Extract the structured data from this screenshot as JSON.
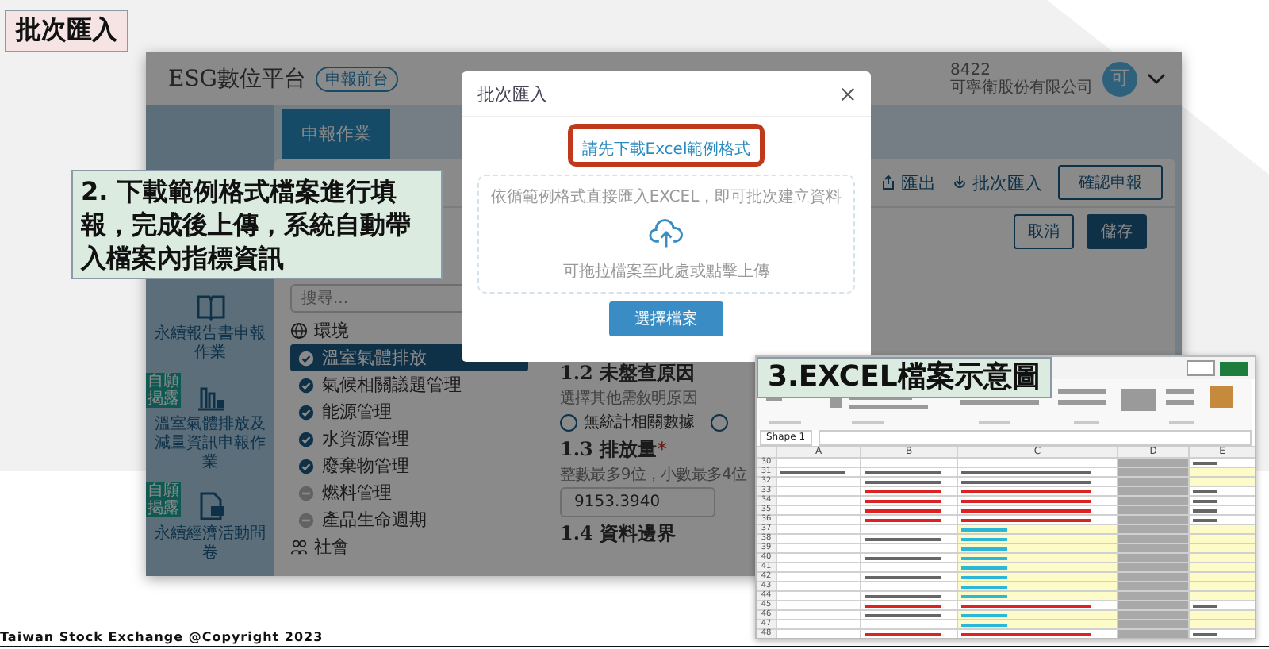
{
  "slide_title": "批次匯入",
  "app": {
    "brand": "ESG數位平台",
    "brand_badge": "申報前台",
    "company_code": "8422",
    "company_name": "可寧衛股份有限公司",
    "avatar": "可",
    "tabs": [
      {
        "label": "申報作業",
        "selected": true
      }
    ],
    "sidebar": [
      {
        "label": "永續報告書申報作業"
      },
      {
        "label": "溫室氣體排放及減量資訊申報作業",
        "badge": "自願揭露"
      },
      {
        "label": "永續經濟活動問卷",
        "badge": "自願揭露"
      }
    ],
    "toolbar": {
      "export": "匯出",
      "import": "批次匯入",
      "confirm": "確認申報"
    },
    "actions": {
      "cancel": "取消",
      "save": "儲存"
    },
    "search": {
      "placeholder": "搜尋..."
    },
    "nav": [
      {
        "label": "環境",
        "items": [
          {
            "label": "溫室氣體排放",
            "checked": true,
            "selected": true
          },
          {
            "label": "氣候相關議題管理",
            "checked": true,
            "selected": false
          },
          {
            "label": "能源管理",
            "checked": true,
            "selected": false
          },
          {
            "label": "水資源管理",
            "checked": true,
            "selected": false
          },
          {
            "label": "廢棄物管理",
            "checked": true,
            "selected": false
          },
          {
            "label": "燃料管理",
            "checked": false,
            "selected": false
          },
          {
            "label": "產品生命週期",
            "checked": false,
            "selected": false
          }
        ]
      },
      {
        "label": "社會"
      }
    ],
    "form": [
      {
        "kind": "radio",
        "title": "1.2 未盤查原因",
        "hint": "選擇其他需敘明原因",
        "options": [
          {
            "label": "無統計相關數據",
            "selected": false
          },
          {
            "selected": false
          }
        ]
      },
      {
        "kind": "input",
        "title": "1.3 排放量",
        "required_mark": "*",
        "hint": "整數最多9位，小數最多4位",
        "value": "9153.3940"
      },
      {
        "kind": "heading",
        "title": "1.4 資料邊界"
      }
    ],
    "modal": {
      "title": "批次匯入",
      "link": "請先下載Excel範例格式",
      "drop_text": "依循範例格式直接匯入EXCEL，即可批次建立資料",
      "drop_hint": "可拖拉檔案至此處或點擊上傳",
      "button": "選擇檔案"
    }
  },
  "callouts": [
    {
      "kind": "step",
      "text": "2. 下載範例格式檔案進行填報，完成後上傳，系統自動帶入檔案內指標資訊"
    },
    {
      "kind": "caption",
      "text": "3.EXCEL檔案示意圖"
    }
  ],
  "excel": {
    "name_box": "Shape 1",
    "columns": [
      "A",
      "B",
      "C",
      "D",
      "E"
    ],
    "rows": [
      {
        "num": "30",
        "kind": "plain"
      },
      {
        "num": "31",
        "kind": "black"
      },
      {
        "num": "32",
        "kind": "black"
      },
      {
        "num": "33",
        "kind": "red"
      },
      {
        "num": "34",
        "kind": "red"
      },
      {
        "num": "35",
        "kind": "red"
      },
      {
        "num": "36",
        "kind": "red"
      },
      {
        "num": "37",
        "kind": "blue"
      },
      {
        "num": "38",
        "kind": "blue"
      },
      {
        "num": "39",
        "kind": "blue"
      },
      {
        "num": "40",
        "kind": "blue"
      },
      {
        "num": "41",
        "kind": "blue"
      },
      {
        "num": "42",
        "kind": "blue"
      },
      {
        "num": "43",
        "kind": "blue"
      },
      {
        "num": "44",
        "kind": "blue"
      },
      {
        "num": "45",
        "kind": "red"
      },
      {
        "num": "46",
        "kind": "blue"
      },
      {
        "num": "47",
        "kind": "blue"
      },
      {
        "num": "48",
        "kind": "red"
      }
    ]
  },
  "footer": "Taiwan Stock Exchange @Copyright 2023"
}
